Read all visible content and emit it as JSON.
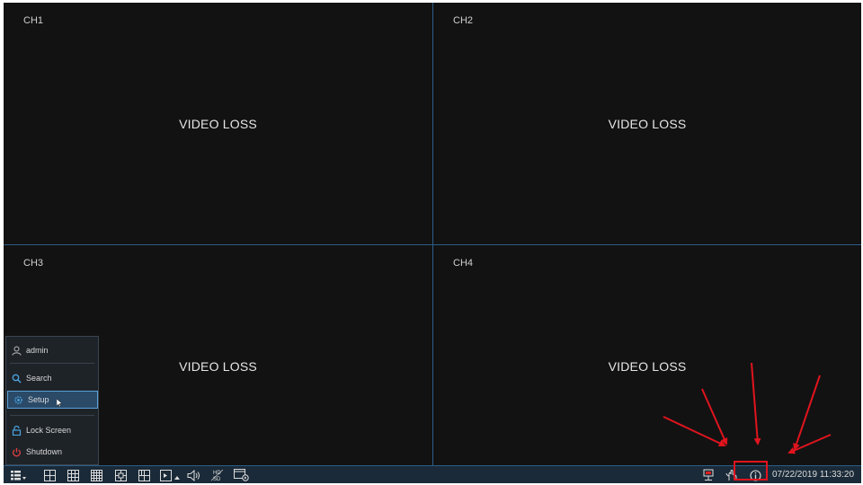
{
  "channels": [
    {
      "label": "CH1",
      "status": "VIDEO LOSS"
    },
    {
      "label": "CH2",
      "status": "VIDEO LOSS"
    },
    {
      "label": "CH3",
      "status": "VIDEO LOSS"
    },
    {
      "label": "CH4",
      "status": "VIDEO LOSS"
    }
  ],
  "menu": {
    "user": "admin",
    "items": [
      {
        "label": "Search",
        "icon": "search-icon"
      },
      {
        "label": "Setup",
        "icon": "gear-icon",
        "selected": true
      },
      {
        "label": "Lock Screen",
        "icon": "lock-icon"
      },
      {
        "label": "Shutdown",
        "icon": "power-icon"
      }
    ]
  },
  "taskbar": {
    "datetime": "07/22/2019 11:33:20",
    "icons": [
      "start-menu-icon",
      "layout-1-icon",
      "layout-4-icon",
      "layout-9-icon",
      "layout-16-icon",
      "layout-custom-icon",
      "layout-pip-icon",
      "sequence-icon",
      "volume-icon",
      "hd-sd-icon",
      "playback-icon",
      "network-icon",
      "manual-record-icon",
      "info-icon"
    ]
  },
  "colors": {
    "accent": "#2c5d86",
    "highlight": "#e0141e"
  }
}
